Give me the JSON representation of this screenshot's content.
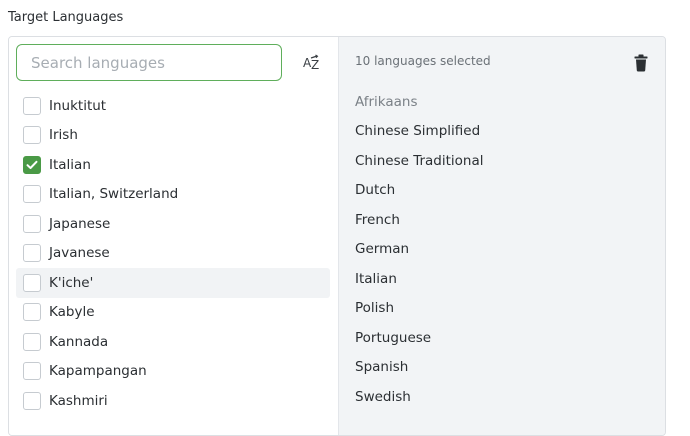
{
  "field_label": "Target Languages",
  "search": {
    "placeholder": "Search languages",
    "value": ""
  },
  "sort_button": {
    "icon": "sort-alpha-icon",
    "label": "AZ"
  },
  "left_list": [
    {
      "label": "Inuktitut",
      "checked": false
    },
    {
      "label": "Irish",
      "checked": false
    },
    {
      "label": "Italian",
      "checked": true
    },
    {
      "label": "Italian, Switzerland",
      "checked": false
    },
    {
      "label": "Japanese",
      "checked": false
    },
    {
      "label": "Javanese",
      "checked": false
    },
    {
      "label": "K'iche'",
      "checked": false
    },
    {
      "label": "Kabyle",
      "checked": false
    },
    {
      "label": "Kannada",
      "checked": false
    },
    {
      "label": "Kapampangan",
      "checked": false
    },
    {
      "label": "Kashmiri",
      "checked": false
    }
  ],
  "selected": {
    "count_text": "10 languages selected",
    "clear_icon": "trash-icon",
    "items": [
      {
        "label": "Afrikaans",
        "muted": true
      },
      {
        "label": "Chinese Simplified"
      },
      {
        "label": "Chinese Traditional"
      },
      {
        "label": "Dutch"
      },
      {
        "label": "French"
      },
      {
        "label": "German"
      },
      {
        "label": "Italian"
      },
      {
        "label": "Polish"
      },
      {
        "label": "Portuguese"
      },
      {
        "label": "Spanish"
      },
      {
        "label": "Swedish"
      }
    ]
  },
  "colors": {
    "accent": "#4a9a46",
    "focus_border": "#5fae5b",
    "panel_bg": "#f2f4f6"
  }
}
